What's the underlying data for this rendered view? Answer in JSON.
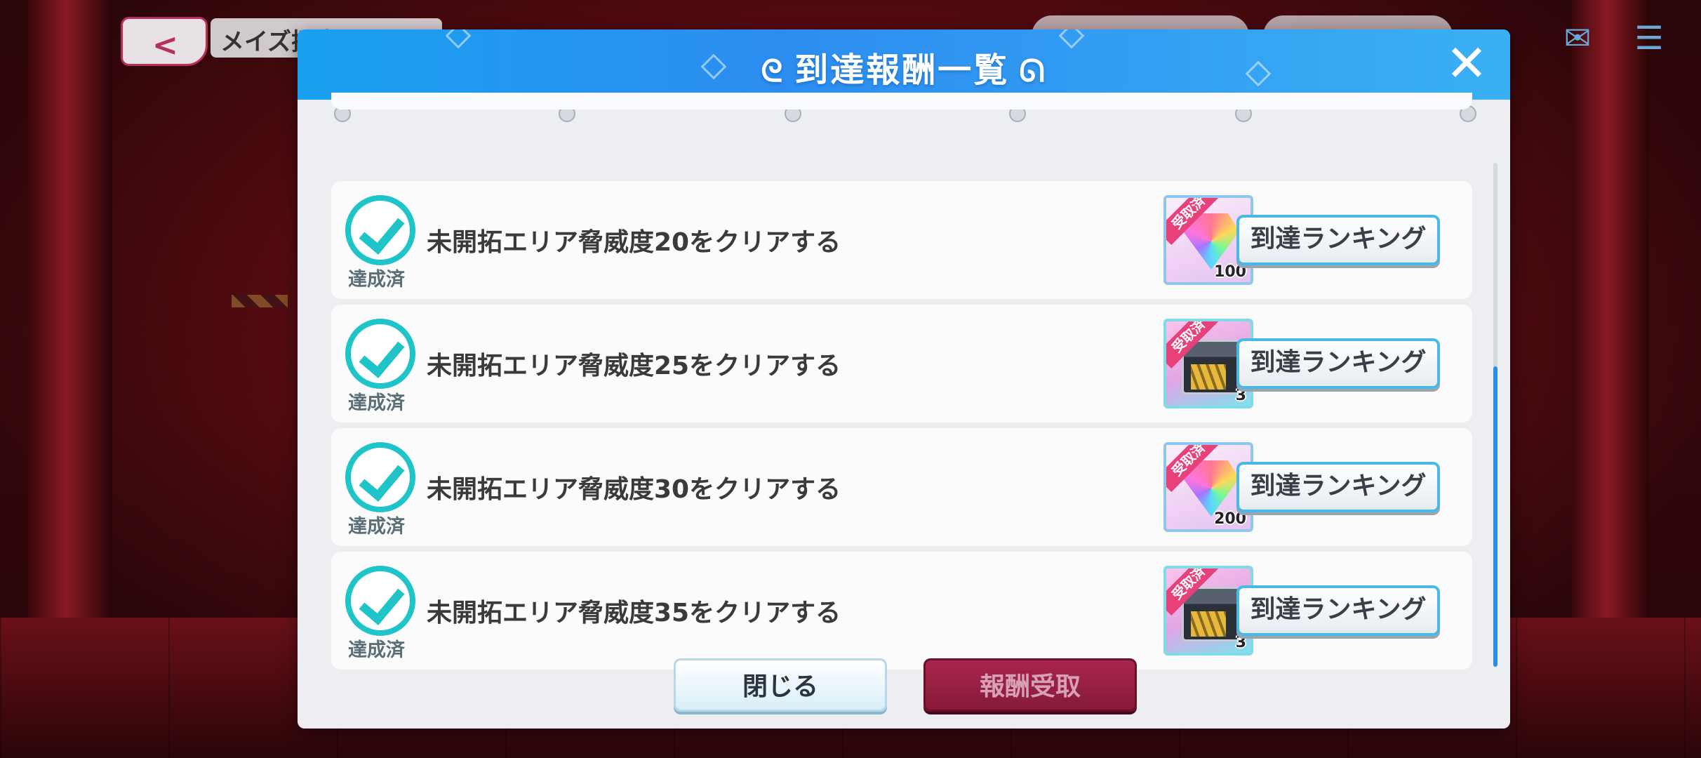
{
  "hud": {
    "back_icon": "chevron-left-icon",
    "screen_title": "メイズ探索",
    "icons": [
      "home-icon",
      "mail-icon",
      "menu-icon"
    ]
  },
  "dialog": {
    "title": "到達報酬一覧",
    "close_icon": "close-icon",
    "rows": [
      {
        "status": "達成済",
        "mission": "未開拓エリア脅威度20をクリアする",
        "reward_type": "gem",
        "reward_badge": "受取済",
        "reward_qty": "100",
        "ranking_label": "到達ランキング"
      },
      {
        "status": "達成済",
        "mission": "未開拓エリア脅威度25をクリアする",
        "reward_type": "box",
        "reward_badge": "受取済",
        "reward_qty": "3",
        "ranking_label": "到達ランキング"
      },
      {
        "status": "達成済",
        "mission": "未開拓エリア脅威度30をクリアする",
        "reward_type": "gem",
        "reward_badge": "受取済",
        "reward_qty": "200",
        "ranking_label": "到達ランキング"
      },
      {
        "status": "達成済",
        "mission": "未開拓エリア脅威度35をクリアする",
        "reward_type": "box",
        "reward_badge": "受取済",
        "reward_qty": "3",
        "ranking_label": "到達ランキング"
      }
    ],
    "buttons": {
      "close_label": "閉じる",
      "receive_label": "報酬受取"
    },
    "colors": {
      "header": "#2c8df0",
      "check": "#1fc4c8",
      "receive_button": "#981f43",
      "claimed_badge": "#e8407a"
    }
  }
}
